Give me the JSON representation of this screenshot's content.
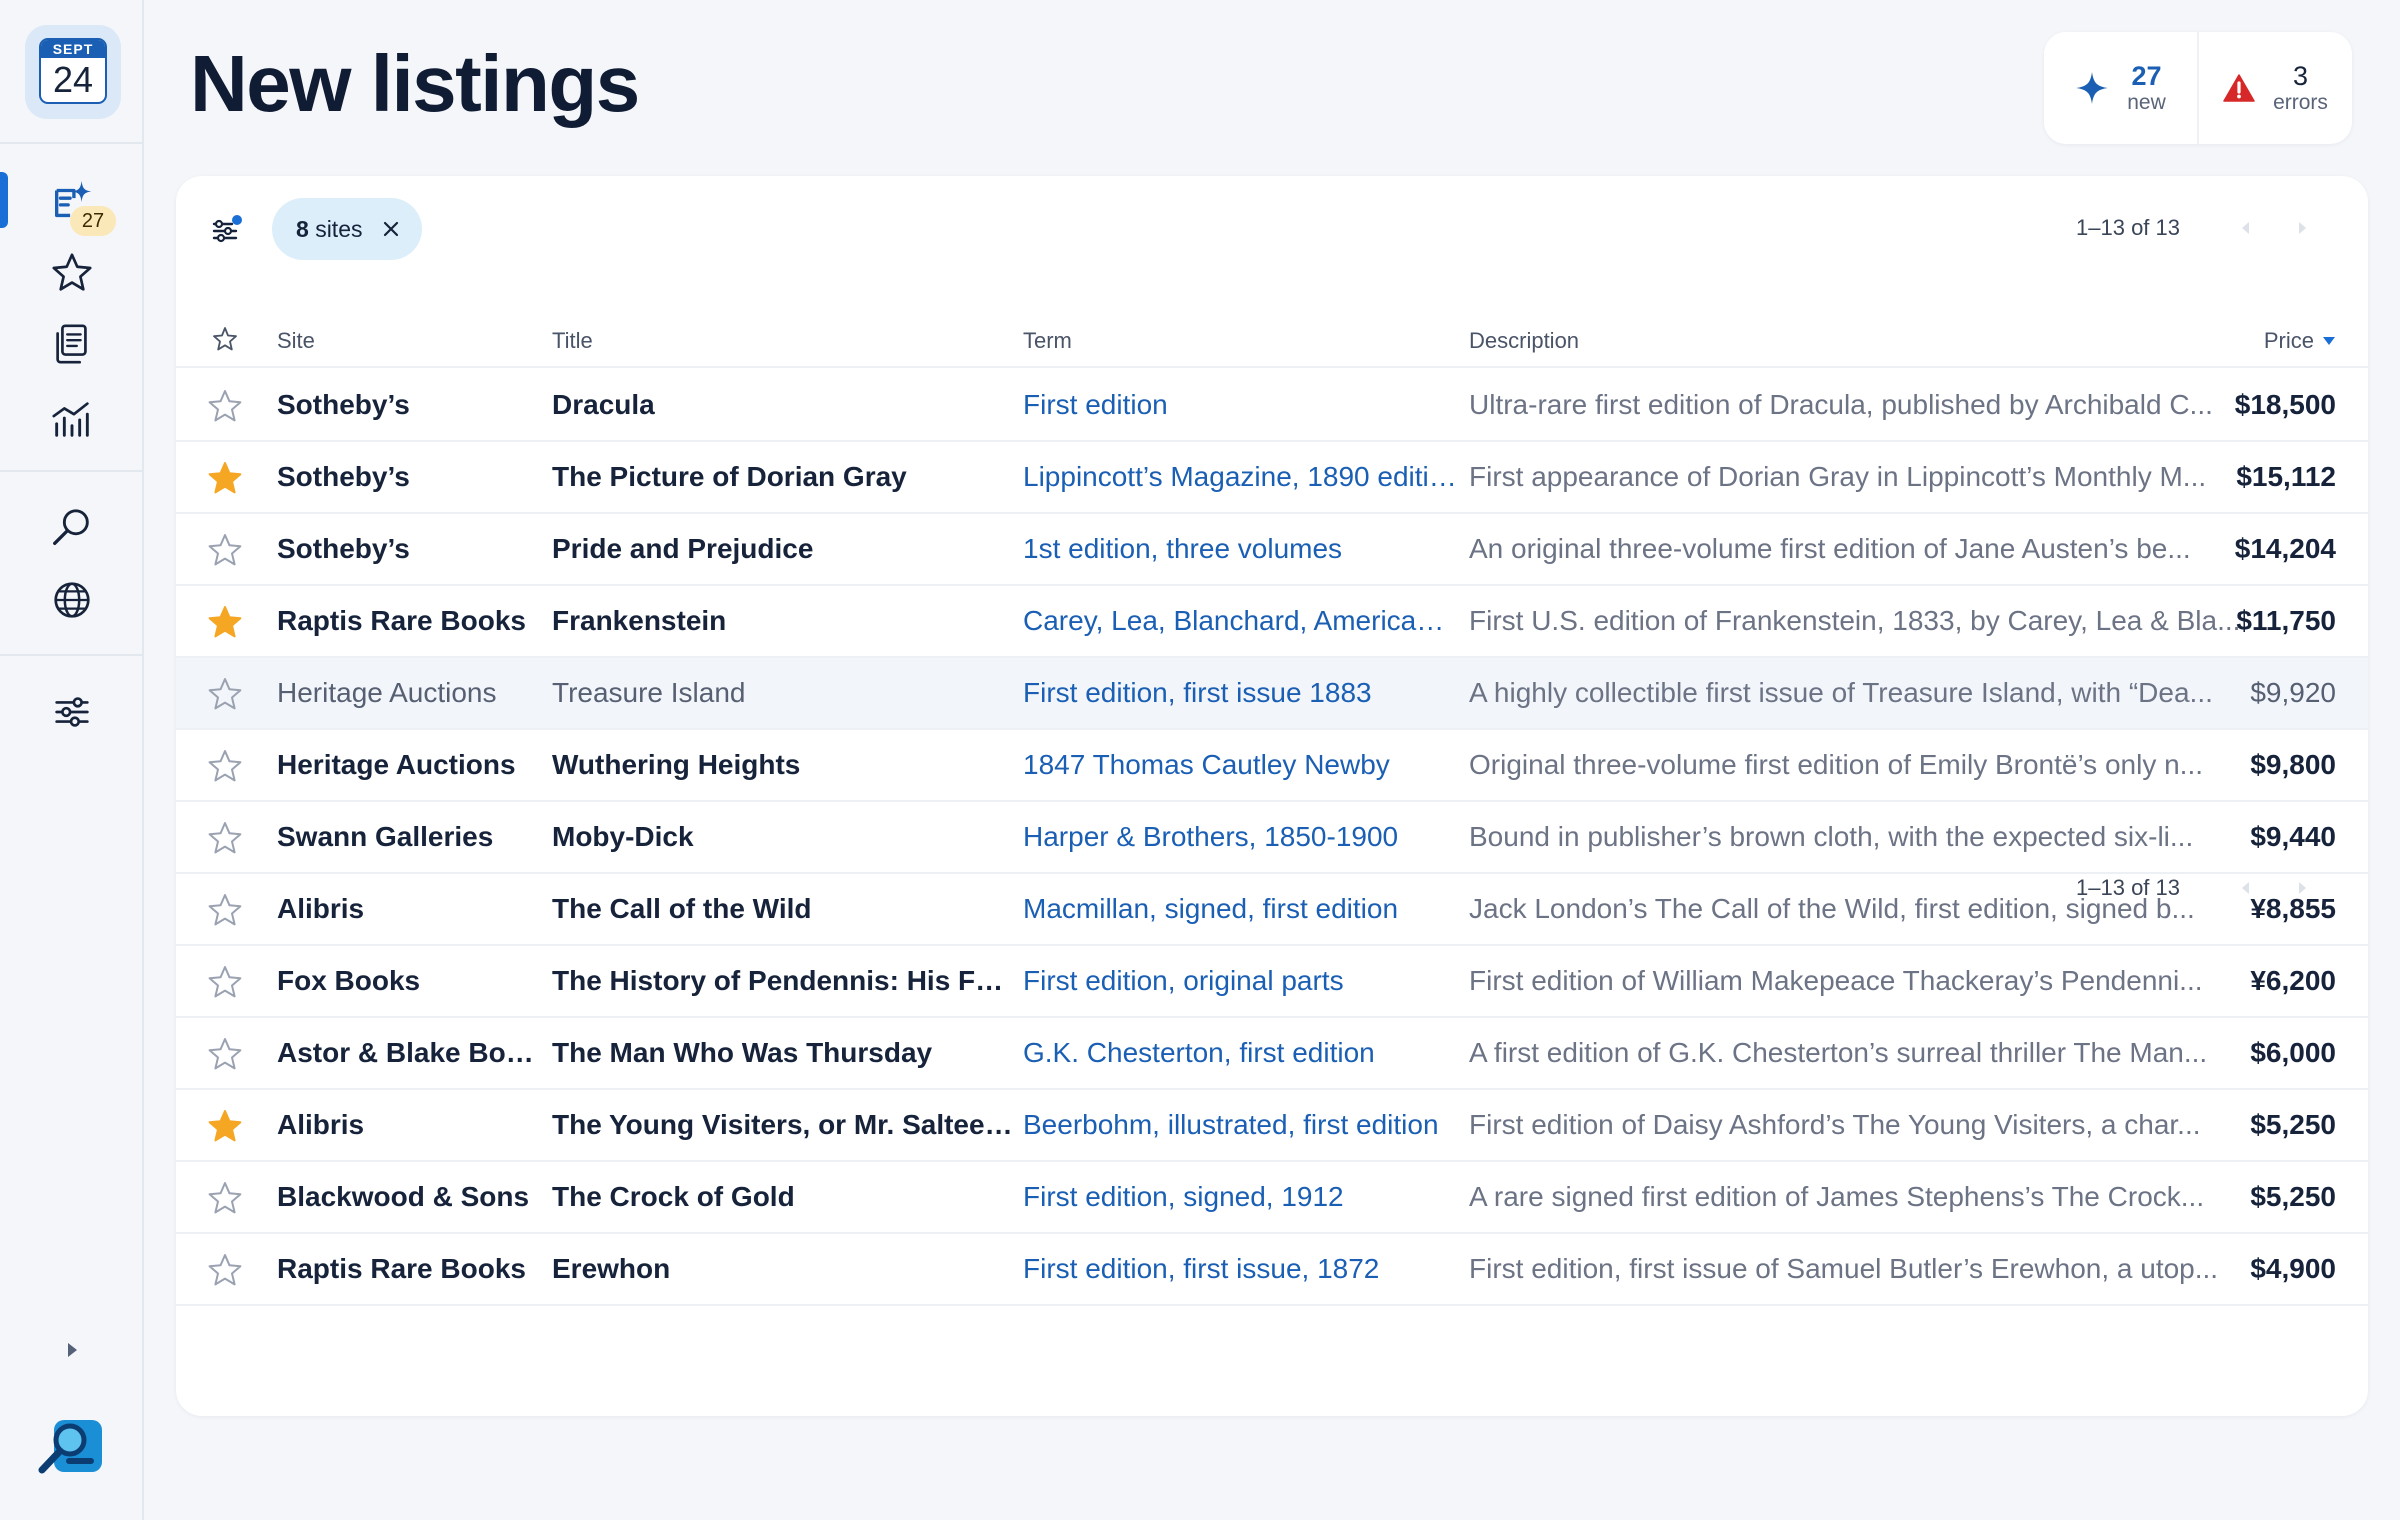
{
  "calendar": {
    "month": "SEPT",
    "day": "24"
  },
  "sidebar": {
    "new_badge": "27",
    "items": [
      {
        "name": "new-listings",
        "icon": "sparkle-document-icon",
        "active": true
      },
      {
        "name": "starred",
        "icon": "star-icon"
      },
      {
        "name": "saved",
        "icon": "documents-icon"
      },
      {
        "name": "stats",
        "icon": "chart-icon"
      },
      {
        "name": "search",
        "icon": "search-icon"
      },
      {
        "name": "sites",
        "icon": "globe-icon"
      },
      {
        "name": "settings",
        "icon": "sliders-icon"
      }
    ]
  },
  "page": {
    "title": "New listings"
  },
  "stats": {
    "new": {
      "count": "27",
      "label": "new",
      "icon": "sparkle-icon",
      "color": "#1a5fb4"
    },
    "errors": {
      "count": "3",
      "label": "errors",
      "icon": "warning-icon",
      "color": "#d62828"
    }
  },
  "filter": {
    "chip_count": "8",
    "chip_label": "sites"
  },
  "pagination": {
    "text": "1–13 of 13"
  },
  "table": {
    "columns": {
      "site": "Site",
      "title": "Title",
      "term": "Term",
      "description": "Description",
      "price": "Price"
    },
    "sort": {
      "column": "price",
      "direction": "desc"
    },
    "rows": [
      {
        "starred": false,
        "site": "Sotheby’s",
        "title": "Dracula",
        "term": "First edition",
        "description": "Ultra-rare first edition of Dracula, published by Archibald C...",
        "price": "$18,500"
      },
      {
        "starred": true,
        "site": "Sotheby’s",
        "title": "The Picture of Dorian Gray",
        "term": "Lippincott’s Magazine, 1890 editio...",
        "description": "First appearance of Dorian Gray in Lippincott’s Monthly M...",
        "price": "$15,112"
      },
      {
        "starred": false,
        "site": "Sotheby’s",
        "title": "Pride and Prejudice",
        "term": "1st edition, three volumes",
        "description": "An original three-volume first edition of Jane Austen’s be...",
        "price": "$14,204"
      },
      {
        "starred": true,
        "site": "Raptis Rare Books",
        "title": "Frankenstein",
        "term": "Carey, Lea, Blanchard, American ...",
        "description": "First U.S. edition of Frankenstein, 1833, by Carey, Lea & Bla...",
        "price": "$11,750"
      },
      {
        "starred": false,
        "site": "Heritage Auctions",
        "title": "Treasure Island",
        "term": "First edition, first issue 1883",
        "description": "A highly collectible first issue of Treasure Island, with “Dea...",
        "price": "$9,920",
        "read": true
      },
      {
        "starred": false,
        "site": "Heritage Auctions",
        "title": "Wuthering Heights",
        "term": "1847 Thomas Cautley Newby",
        "description": "Original three-volume first edition of Emily Brontë’s only n...",
        "price": "$9,800"
      },
      {
        "starred": false,
        "site": "Swann Galleries",
        "title": "Moby-Dick",
        "term": "Harper & Brothers, 1850-1900",
        "description": "Bound in publisher’s brown cloth, with the expected six-li...",
        "price": "$9,440"
      },
      {
        "starred": false,
        "site": "Alibris",
        "title": "The Call of the Wild",
        "term": "Macmillan, signed, first edition",
        "description": "Jack London’s The Call of the Wild, first edition, signed b...",
        "price": "¥8,855"
      },
      {
        "starred": false,
        "site": "Fox Books",
        "title": "The History of Pendennis: His Fort...",
        "term": "First edition, original parts",
        "description": "First edition of William Makepeace Thackeray’s Pendenni...",
        "price": "¥6,200"
      },
      {
        "starred": false,
        "site": "Astor & Blake Books",
        "title": "The Man Who Was Thursday",
        "term": "G.K. Chesterton, first edition",
        "description": "A first edition of G.K. Chesterton’s surreal thriller The Man...",
        "price": "$6,000"
      },
      {
        "starred": true,
        "site": "Alibris",
        "title": "The Young Visiters, or Mr. Salteen...",
        "term": "Beerbohm, illustrated, first edition",
        "description": "First edition of Daisy Ashford’s The Young Visiters, a char...",
        "price": "$5,250"
      },
      {
        "starred": false,
        "site": "Blackwood & Sons",
        "title": "The Crock of Gold",
        "term": "First edition, signed, 1912",
        "description": "A rare signed first edition of James Stephens’s The Crock...",
        "price": "$5,250"
      },
      {
        "starred": false,
        "site": "Raptis Rare Books",
        "title": "Erewhon",
        "term": "First edition, first issue, 1872",
        "description": "First edition, first issue of Samuel Butler’s Erewhon, a utop...",
        "price": "$4,900"
      }
    ]
  },
  "colors": {
    "accent": "#1a5fb4",
    "star": "#f5a623",
    "error": "#d62828"
  }
}
